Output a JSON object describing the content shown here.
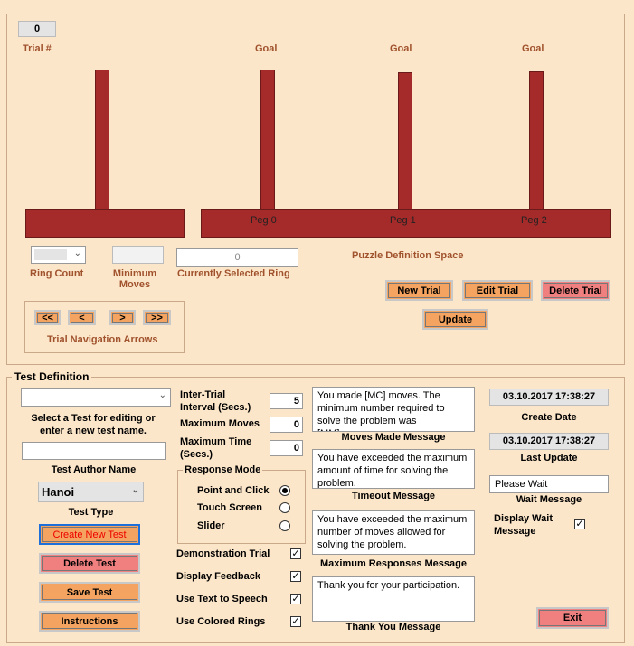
{
  "puzzle": {
    "trial_number": "0",
    "trial_label": "Trial #",
    "goal_labels": [
      "Goal",
      "Goal",
      "Goal"
    ],
    "peg_labels": [
      "Peg 0",
      "Peg 1",
      "Peg 2"
    ],
    "ring_count_label": "Ring Count",
    "minimum_moves_label": "Minimum Moves",
    "selected_ring_value": "0",
    "selected_ring_label": "Currently Selected Ring",
    "definition_space_label": "Puzzle Definition Space",
    "buttons": {
      "new_trial": "New Trial",
      "edit_trial": "Edit Trial",
      "delete_trial": "Delete Trial",
      "update": "Update"
    },
    "nav": {
      "first": "<<",
      "prev": "<",
      "next": ">",
      "last": ">>",
      "label": "Trial Navigation Arrows"
    }
  },
  "test_def": {
    "title": "Test Definition",
    "select_test_value": "",
    "select_test_label": "Select a Test for editing or enter a new test name.",
    "author_value": "",
    "author_label": "Test Author Name",
    "test_type_value": "Hanoi",
    "test_type_label": "Test Type",
    "buttons": {
      "create": "Create New Test",
      "delete": "Delete Test",
      "save": "Save Test",
      "instructions": "Instructions",
      "exit": "Exit"
    },
    "inter_trial_label": "Inter-Trial Interval (Secs.)",
    "inter_trial_value": "5",
    "max_moves_label": "Maximum Moves",
    "max_moves_value": "0",
    "max_time_label": "Maximum Time (Secs.)",
    "max_time_value": "0",
    "response_mode_label": "Response Mode",
    "response_modes": [
      "Point and Click",
      "Touch Screen",
      "Slider"
    ],
    "response_mode_selected": "Point and Click",
    "options": [
      {
        "label": "Demonstration Trial",
        "checked": true
      },
      {
        "label": "Display Feedback",
        "checked": true
      },
      {
        "label": "Use Text to Speech",
        "checked": true
      },
      {
        "label": "Use Colored Rings",
        "checked": true
      }
    ],
    "messages": {
      "moves_made_text": "You made [MC] moves. The minimum number required to solve the problem was [MM]moves.",
      "moves_made_label": "Moves Made Message",
      "timeout_text": "You have exceeded the maximum amount of time for solving the problem.",
      "timeout_label": "Timeout Message",
      "max_responses_text": "You have exceeded the maximum number of moves allowed for solving the problem.",
      "max_responses_label": "Maximum Responses Message",
      "thank_you_text": "Thank you for your participation.",
      "thank_you_label": "Thank You Message"
    },
    "create_date_value": "03.10.2017 17:38:27",
    "create_date_label": "Create Date",
    "last_update_value": "03.10.2017 17:38:27",
    "last_update_label": "Last Update",
    "wait_message_value": "Please Wait",
    "wait_message_label": "Wait Message",
    "display_wait_label": "Display Wait Message",
    "display_wait_checked": true
  },
  "colors": {
    "background": "#fce6c9",
    "peg": "#a52a2a",
    "button": "#f4a460",
    "delete_button": "#f08080"
  }
}
